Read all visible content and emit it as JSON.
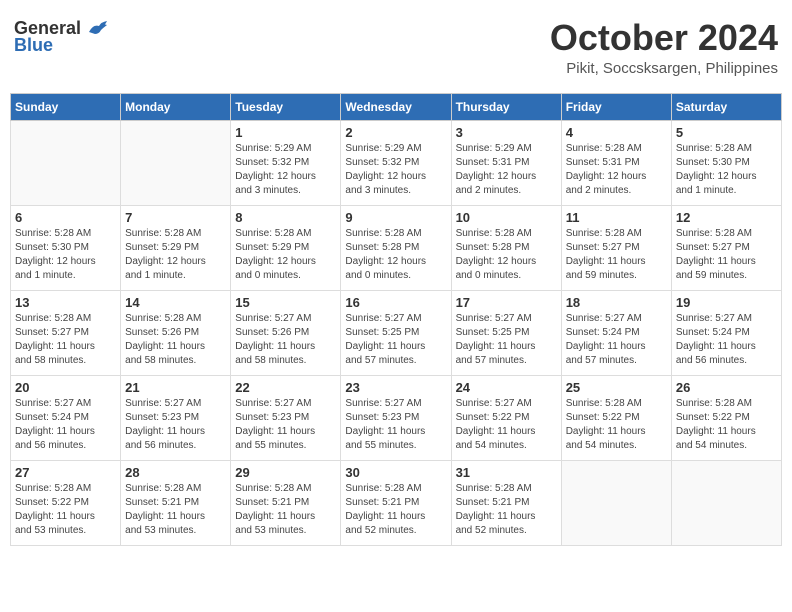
{
  "logo": {
    "general": "General",
    "blue": "Blue"
  },
  "header": {
    "month": "October 2024",
    "location": "Pikit, Soccsksargen, Philippines"
  },
  "weekdays": [
    "Sunday",
    "Monday",
    "Tuesday",
    "Wednesday",
    "Thursday",
    "Friday",
    "Saturday"
  ],
  "weeks": [
    [
      {
        "day": "",
        "detail": ""
      },
      {
        "day": "",
        "detail": ""
      },
      {
        "day": "1",
        "detail": "Sunrise: 5:29 AM\nSunset: 5:32 PM\nDaylight: 12 hours\nand 3 minutes."
      },
      {
        "day": "2",
        "detail": "Sunrise: 5:29 AM\nSunset: 5:32 PM\nDaylight: 12 hours\nand 3 minutes."
      },
      {
        "day": "3",
        "detail": "Sunrise: 5:29 AM\nSunset: 5:31 PM\nDaylight: 12 hours\nand 2 minutes."
      },
      {
        "day": "4",
        "detail": "Sunrise: 5:28 AM\nSunset: 5:31 PM\nDaylight: 12 hours\nand 2 minutes."
      },
      {
        "day": "5",
        "detail": "Sunrise: 5:28 AM\nSunset: 5:30 PM\nDaylight: 12 hours\nand 1 minute."
      }
    ],
    [
      {
        "day": "6",
        "detail": "Sunrise: 5:28 AM\nSunset: 5:30 PM\nDaylight: 12 hours\nand 1 minute."
      },
      {
        "day": "7",
        "detail": "Sunrise: 5:28 AM\nSunset: 5:29 PM\nDaylight: 12 hours\nand 1 minute."
      },
      {
        "day": "8",
        "detail": "Sunrise: 5:28 AM\nSunset: 5:29 PM\nDaylight: 12 hours\nand 0 minutes."
      },
      {
        "day": "9",
        "detail": "Sunrise: 5:28 AM\nSunset: 5:28 PM\nDaylight: 12 hours\nand 0 minutes."
      },
      {
        "day": "10",
        "detail": "Sunrise: 5:28 AM\nSunset: 5:28 PM\nDaylight: 12 hours\nand 0 minutes."
      },
      {
        "day": "11",
        "detail": "Sunrise: 5:28 AM\nSunset: 5:27 PM\nDaylight: 11 hours\nand 59 minutes."
      },
      {
        "day": "12",
        "detail": "Sunrise: 5:28 AM\nSunset: 5:27 PM\nDaylight: 11 hours\nand 59 minutes."
      }
    ],
    [
      {
        "day": "13",
        "detail": "Sunrise: 5:28 AM\nSunset: 5:27 PM\nDaylight: 11 hours\nand 58 minutes."
      },
      {
        "day": "14",
        "detail": "Sunrise: 5:28 AM\nSunset: 5:26 PM\nDaylight: 11 hours\nand 58 minutes."
      },
      {
        "day": "15",
        "detail": "Sunrise: 5:27 AM\nSunset: 5:26 PM\nDaylight: 11 hours\nand 58 minutes."
      },
      {
        "day": "16",
        "detail": "Sunrise: 5:27 AM\nSunset: 5:25 PM\nDaylight: 11 hours\nand 57 minutes."
      },
      {
        "day": "17",
        "detail": "Sunrise: 5:27 AM\nSunset: 5:25 PM\nDaylight: 11 hours\nand 57 minutes."
      },
      {
        "day": "18",
        "detail": "Sunrise: 5:27 AM\nSunset: 5:24 PM\nDaylight: 11 hours\nand 57 minutes."
      },
      {
        "day": "19",
        "detail": "Sunrise: 5:27 AM\nSunset: 5:24 PM\nDaylight: 11 hours\nand 56 minutes."
      }
    ],
    [
      {
        "day": "20",
        "detail": "Sunrise: 5:27 AM\nSunset: 5:24 PM\nDaylight: 11 hours\nand 56 minutes."
      },
      {
        "day": "21",
        "detail": "Sunrise: 5:27 AM\nSunset: 5:23 PM\nDaylight: 11 hours\nand 56 minutes."
      },
      {
        "day": "22",
        "detail": "Sunrise: 5:27 AM\nSunset: 5:23 PM\nDaylight: 11 hours\nand 55 minutes."
      },
      {
        "day": "23",
        "detail": "Sunrise: 5:27 AM\nSunset: 5:23 PM\nDaylight: 11 hours\nand 55 minutes."
      },
      {
        "day": "24",
        "detail": "Sunrise: 5:27 AM\nSunset: 5:22 PM\nDaylight: 11 hours\nand 54 minutes."
      },
      {
        "day": "25",
        "detail": "Sunrise: 5:28 AM\nSunset: 5:22 PM\nDaylight: 11 hours\nand 54 minutes."
      },
      {
        "day": "26",
        "detail": "Sunrise: 5:28 AM\nSunset: 5:22 PM\nDaylight: 11 hours\nand 54 minutes."
      }
    ],
    [
      {
        "day": "27",
        "detail": "Sunrise: 5:28 AM\nSunset: 5:22 PM\nDaylight: 11 hours\nand 53 minutes."
      },
      {
        "day": "28",
        "detail": "Sunrise: 5:28 AM\nSunset: 5:21 PM\nDaylight: 11 hours\nand 53 minutes."
      },
      {
        "day": "29",
        "detail": "Sunrise: 5:28 AM\nSunset: 5:21 PM\nDaylight: 11 hours\nand 53 minutes."
      },
      {
        "day": "30",
        "detail": "Sunrise: 5:28 AM\nSunset: 5:21 PM\nDaylight: 11 hours\nand 52 minutes."
      },
      {
        "day": "31",
        "detail": "Sunrise: 5:28 AM\nSunset: 5:21 PM\nDaylight: 11 hours\nand 52 minutes."
      },
      {
        "day": "",
        "detail": ""
      },
      {
        "day": "",
        "detail": ""
      }
    ]
  ]
}
